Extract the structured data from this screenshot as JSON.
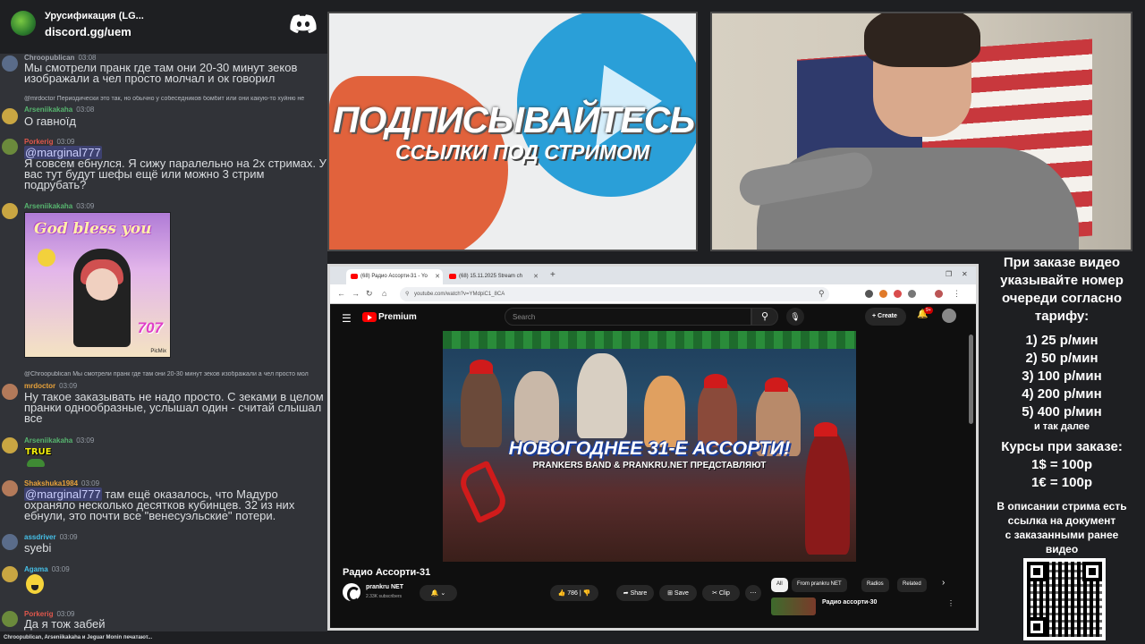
{
  "discord": {
    "server_name": "Урусификация (LG...",
    "invite": "discord.gg/uem",
    "icon": "discord-logo-icon"
  },
  "chat": {
    "messages": [
      {
        "author": "Chroopublican",
        "time": "03:08",
        "text": "Мы смотрели пранк где там они 20-30 минут зеков изображали а чел просто молчал и ок говорил"
      },
      {
        "reply_to": "@mrdoctor Периодически это так, но обычно у собеседников бомбит или они какую-то хуйню не"
      },
      {
        "author": "Arseniikakaha",
        "time": "03:08",
        "text": "О гавноїд"
      },
      {
        "author": "Porkerig",
        "time": "03:09",
        "mention": "@marginal777",
        "text": "Я совсем ебнулся. Я сижу паралельно на 2х стримах. У вас тут будут шефы ещё или можно 3 стрим подрубать?"
      },
      {
        "author": "Arseniikakaha",
        "time": "03:09",
        "image_title": "God bless you",
        "image_number": "707",
        "image_tag": "PicMix"
      },
      {
        "reply_to": "@Chroopublican Мы смотрели пранк где там они 20-30 минут зеков изображали а чел просто мол"
      },
      {
        "author": "mrdoctor",
        "time": "03:09",
        "text": "Ну такое заказывать не надо просто. С зеками в целом пранки однообразные, услышал один - считай слышал все"
      },
      {
        "author": "Arseniikakaha",
        "time": "03:09",
        "emote": "TRUE"
      },
      {
        "author": "Shakshuka1984",
        "time": "03:09",
        "mention": "@marginal777",
        "text": "там ещё оказалось, что Мадуро охраняло несколько десятков кубинцев. 32 из них ебнули, это почти все \"венесуэльские\" потери."
      },
      {
        "author": "assdriver",
        "time": "03:09",
        "text": "syebi"
      },
      {
        "author": "Agama",
        "time": "03:09"
      },
      {
        "author": "Porkerig",
        "time": "03:09",
        "text": "Да я тож забей"
      }
    ],
    "typing": "Chroopublican, Arseniikakaha и Jeguar Monin печатают..."
  },
  "banner": {
    "title": "ПОДПИСЫВАЙТЕСЬ",
    "subtitle": "ССЫЛКИ ПОД СТРИМОМ"
  },
  "browser": {
    "tabs": [
      {
        "label": "(68) Радио Ассорти-31 - Yo",
        "active": true
      },
      {
        "label": "(68) 15.11.2025 Stream ch",
        "active": false
      }
    ],
    "url": "youtube.com/watch?v=YMdpiC1_8CA"
  },
  "youtube": {
    "logo_text": "Premium",
    "search_placeholder": "Search",
    "create_label": "Create",
    "notif_badge": "9+",
    "video": {
      "title_overlay": "НОВОГОДНЕЕ 31-Е АССОРТИ!",
      "subtitle_overlay": "PRANKERS BAND & PRANKRU.NET ПРЕДСТАВЛЯЮТ"
    },
    "title": "Радио Ассорти-31",
    "channel": "prankru NET",
    "subscribers": "2.33K subscribers",
    "likes": "786",
    "share": "Share",
    "save": "Save",
    "clip": "Clip",
    "chips": [
      "All",
      "From prankru NET",
      "Radios",
      "Related"
    ],
    "rec_title": "Радио ассорти-30"
  },
  "info": {
    "intro": [
      "При заказе видео",
      "указывайте номер",
      "очереди согласно",
      "тарифу:"
    ],
    "tariffs": [
      "1) 25 р/мин",
      "2) 50 р/мин",
      "3) 100 р/мин",
      "4) 200 р/мин",
      "5) 400 р/мин"
    ],
    "etc": "и так далее",
    "rates_title": "Курсы при заказе:",
    "rates": [
      "1$ = 100р",
      "1€ = 100р"
    ],
    "footer": [
      "В описании стрима есть",
      "ссылка на документ",
      "с заказанными ранее",
      "видео"
    ]
  }
}
